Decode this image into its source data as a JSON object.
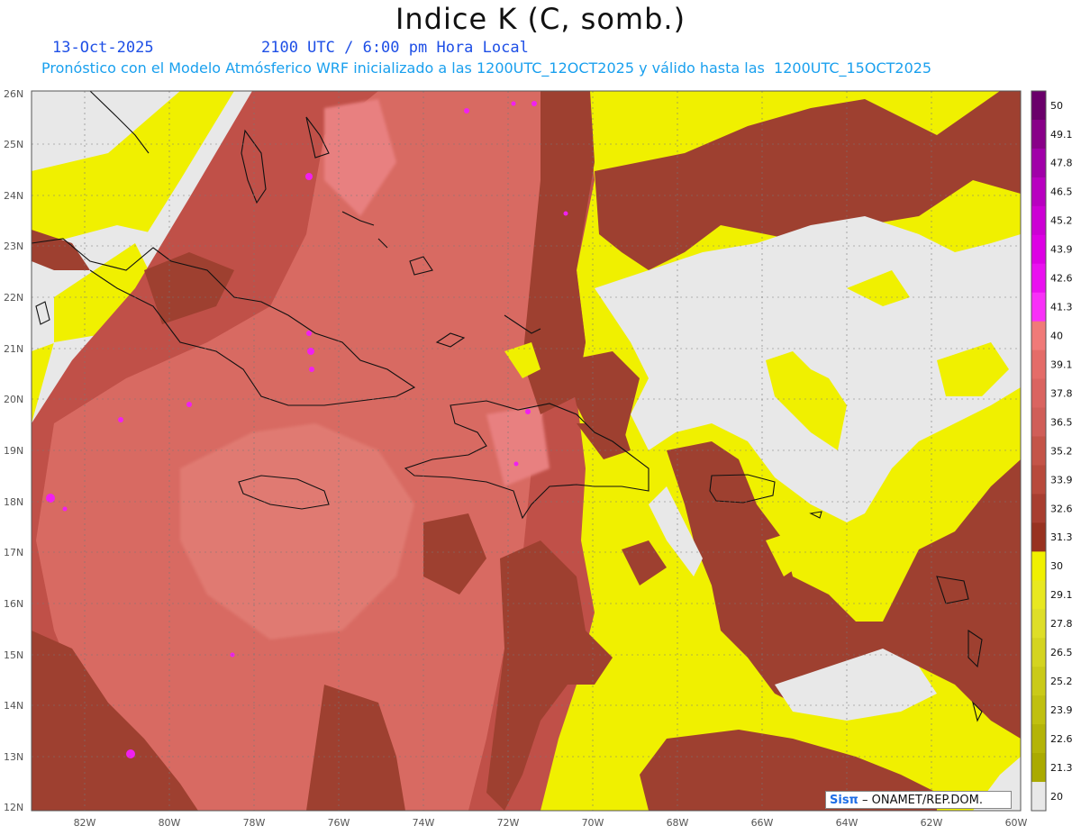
{
  "title": "Indice K (C, somb.)",
  "date": "13-Oct-2025",
  "time_label": "2100 UTC / 6:00 pm Hora Local",
  "forecast_line": "Pronóstico con el Modelo Atmósferico WRF inicializado a las 1200UTC_12OCT2025 y válido hasta las  1200UTC_15OCT2025",
  "footer": {
    "prefix": "Sisπ",
    "suffix": " – ONAMET/REP.DOM."
  },
  "lat_labels": [
    "26N",
    "25N",
    "24N",
    "23N",
    "22N",
    "21N",
    "20N",
    "19N",
    "18N",
    "17N",
    "16N",
    "15N",
    "14N",
    "13N",
    "12N"
  ],
  "lon_labels": [
    "82W",
    "80W",
    "78W",
    "76W",
    "74W",
    "72W",
    "70W",
    "68W",
    "66W",
    "64W",
    "62W",
    "60W"
  ],
  "colorbar": {
    "levels": [
      "50",
      "49.1",
      "47.8",
      "46.5",
      "45.2",
      "43.9",
      "42.6",
      "41.3",
      "40",
      "39.1",
      "37.8",
      "36.5",
      "35.2",
      "33.9",
      "32.6",
      "31.3",
      "30",
      "29.1",
      "27.8",
      "26.5",
      "25.2",
      "23.9",
      "22.6",
      "21.3",
      "20"
    ],
    "colors": [
      "#6a006a",
      "#880088",
      "#a000a8",
      "#b800c0",
      "#cc00d4",
      "#dd00e4",
      "#ea10f0",
      "#f830f8",
      "#f07a78",
      "#e46c68",
      "#da6460",
      "#d05e58",
      "#c45448",
      "#b84a3c",
      "#a83e30",
      "#983220",
      "#f0f000",
      "#e8e820",
      "#dede28",
      "#d4d420",
      "#caca18",
      "#c0c010",
      "#b4b408",
      "#aaaa00",
      "#e8e8e8"
    ]
  },
  "field_colors": {
    "ocean_low": "#e8e8e8",
    "yellow": "#f0f000",
    "yellow_light": "#e0e840",
    "dark_red": "#9e4030",
    "mid_red": "#c05048",
    "salmon": "#d86a62",
    "pink_highlight": "#e88080",
    "magenta": "#f020f0"
  }
}
